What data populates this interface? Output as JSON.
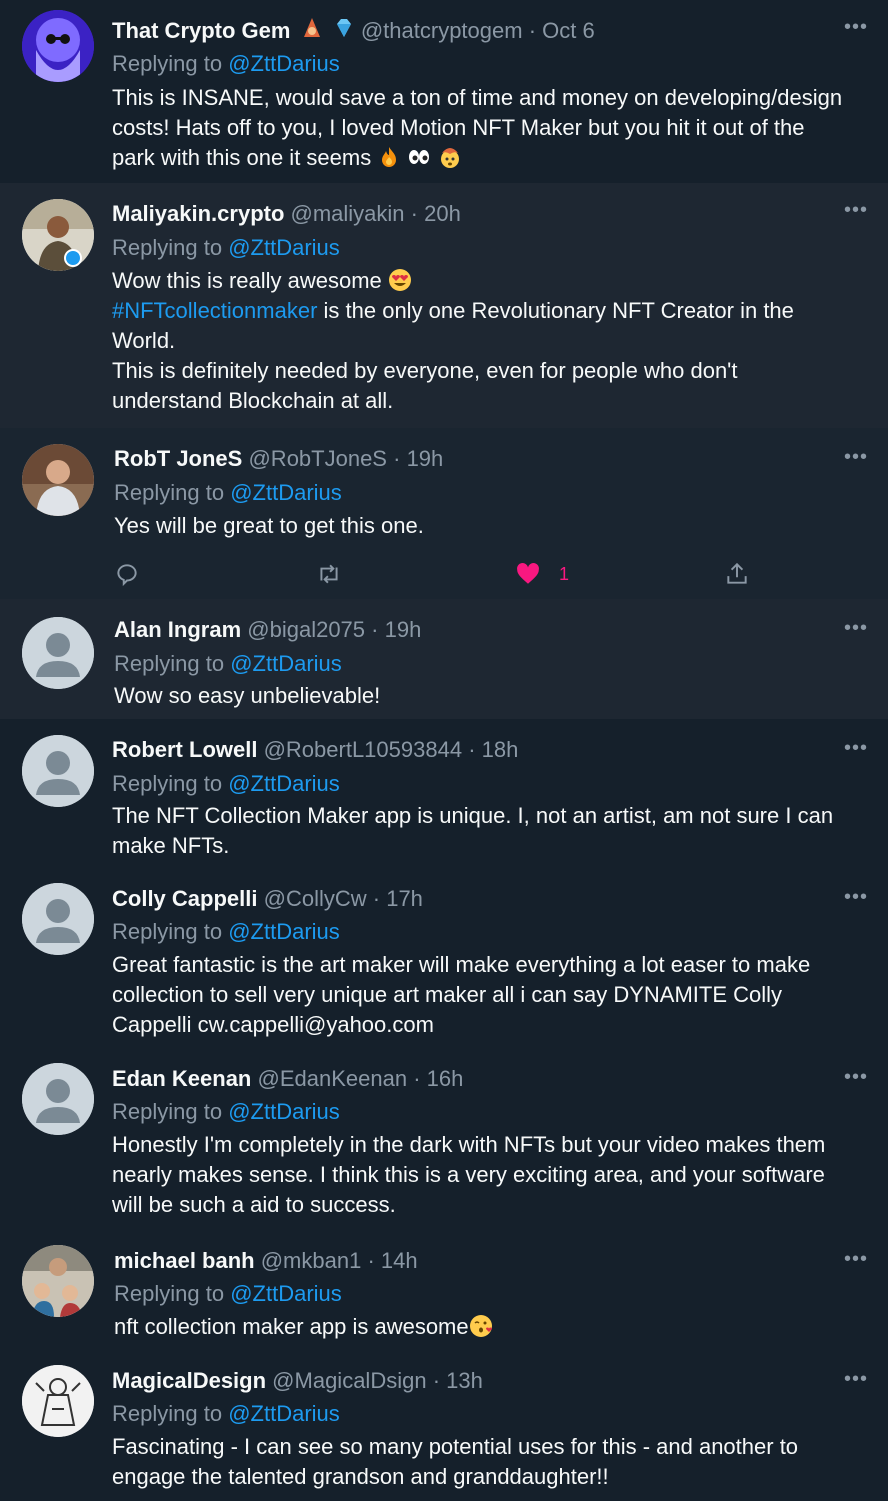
{
  "replying_label": "Replying to",
  "tweets": [
    {
      "name": "That Crypto Gem",
      "handle": "@thatcryptogem",
      "time": "Oct 6",
      "reply_to": "@ZttDarius",
      "lines": [
        "This is INSANE, would save a ton of time and money on developing/design",
        "costs! Hats off to you, I loved Motion NFT Maker but you hit it out of the",
        "park with this one it seems"
      ]
    },
    {
      "name": "Maliyakin.crypto",
      "handle": "@maliyakin",
      "time": "20h",
      "reply_to": "@ZttDarius",
      "line1": "Wow this is really awesome",
      "hashtag": "#NFTcollectionmaker",
      "line2_rest": " is the only one Revolutionary NFT Creator in the",
      "lines": [
        "World.",
        "This is definitely needed by everyone, even for people who don't",
        "understand Blockchain at all."
      ]
    },
    {
      "name": "RobT JoneS",
      "handle": "@RobTJoneS",
      "time": "19h",
      "reply_to": "@ZttDarius",
      "lines": [
        "Yes will be great to get this one."
      ],
      "like_count": "1"
    },
    {
      "name": "Alan Ingram",
      "handle": "@bigal2075",
      "time": "19h",
      "reply_to": "@ZttDarius",
      "lines": [
        "Wow so easy unbelievable!"
      ]
    },
    {
      "name": "Robert Lowell",
      "handle": "@RobertL10593844",
      "time": "18h",
      "reply_to": "@ZttDarius",
      "lines": [
        "The NFT Collection Maker app is unique.  I, not an artist, am not sure I can",
        "make NFTs."
      ]
    },
    {
      "name": "Colly Cappelli",
      "handle": "@CollyCw",
      "time": "17h",
      "reply_to": "@ZttDarius",
      "lines": [
        "Great fantastic is the art maker will make everything a lot easer to make",
        "collection to sell very unique art maker all i can say DYNAMITE   Colly",
        "Cappelli  cw.cappelli@yahoo.com"
      ]
    },
    {
      "name": "Edan Keenan",
      "handle": "@EdanKeenan",
      "time": "16h",
      "reply_to": "@ZttDarius",
      "lines": [
        "Honestly I'm completely in the dark with NFTs but your video makes them",
        "nearly makes sense.  I think this is a very exciting area, and your software",
        "will be such a aid to success."
      ]
    },
    {
      "name": "michael banh",
      "handle": "@mkban1",
      "time": "14h",
      "reply_to": "@ZttDarius",
      "lines": [
        "nft collection maker app is awesome"
      ]
    },
    {
      "name": "MagicalDesign",
      "handle": "@MagicalDsign",
      "time": "13h",
      "reply_to": "@ZttDarius",
      "lines": [
        "Fascinating - I can see so many potential uses for this - and another to",
        "engage the talented grandson and granddaughter!!"
      ]
    }
  ],
  "colors": {
    "background": "#15202b",
    "alt_background": "#1e2732",
    "text": "#f7f9f9",
    "secondary": "#8b98a5",
    "link": "#1d9bf0",
    "like": "#f91880"
  }
}
